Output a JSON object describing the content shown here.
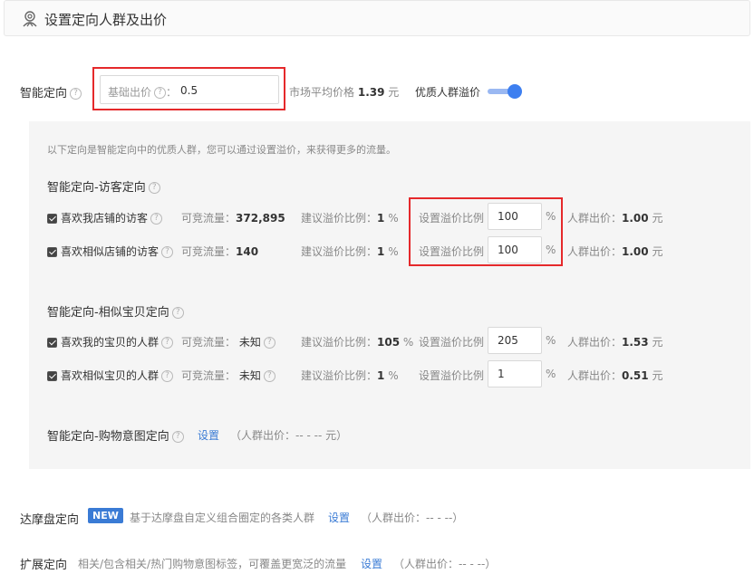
{
  "header": {
    "title": "设置定向人群及出价"
  },
  "smart": {
    "label": "智能定向",
    "base_price_label": "基础出价",
    "base_price_colon": "：",
    "base_price_value": "0.5",
    "market_avg_label": "市场平均价格",
    "market_avg_value": "1.39",
    "market_avg_unit": "元",
    "premium_label": "优质人群溢价",
    "premium_enabled": true,
    "desc": "以下定向是智能定向中的优质人群，您可以通过设置溢价，来获得更多的流量。"
  },
  "groups": [
    {
      "title": "智能定向-访客定向",
      "rows": [
        {
          "name": "喜欢我店铺的访客",
          "traffic_label": "可竞流量：",
          "traffic": "372,895",
          "suggest_label": "建议溢价比例：",
          "suggest": "1",
          "set_label": "设置溢价比例",
          "value": "100",
          "unit": "%",
          "bid_label": "人群出价：",
          "bid": "1.00",
          "bid_unit": "元"
        },
        {
          "name": "喜欢相似店铺的访客",
          "traffic_label": "可竞流量：",
          "traffic": "140",
          "suggest_label": "建议溢价比例：",
          "suggest": "1",
          "set_label": "设置溢价比例",
          "value": "100",
          "unit": "%",
          "bid_label": "人群出价：",
          "bid": "1.00",
          "bid_unit": "元"
        }
      ]
    },
    {
      "title": "智能定向-相似宝贝定向",
      "rows": [
        {
          "name": "喜欢我的宝贝的人群",
          "traffic_label": "可竞流量：",
          "traffic": "未知",
          "suggest_label": "建议溢价比例：",
          "suggest": "105",
          "set_label": "设置溢价比例",
          "value": "205",
          "unit": "%",
          "bid_label": "人群出价：",
          "bid": "1.53",
          "bid_unit": "元"
        },
        {
          "name": "喜欢相似宝贝的人群",
          "traffic_label": "可竞流量：",
          "traffic": "未知",
          "suggest_label": "建议溢价比例：",
          "suggest": "1",
          "set_label": "设置溢价比例",
          "value": "1",
          "unit": "%",
          "bid_label": "人群出价：",
          "bid": "0.51",
          "bid_unit": "元"
        }
      ]
    }
  ],
  "intent": {
    "title": "智能定向-购物意图定向",
    "setting": "设置",
    "bid_text": "（人群出价：-- - -- 元）"
  },
  "damopan": {
    "label": "达摩盘定向",
    "badge": "NEW",
    "desc": "基于达摩盘自定义组合圈定的各类人群",
    "setting": "设置",
    "bid_text": "（人群出价：-- - --）"
  },
  "extend": {
    "label": "扩展定向",
    "desc": "相关/包含相关/热门购物意图标签，可覆盖更宽泛的流量",
    "setting": "设置",
    "bid_text": "（人群出价：-- - --）"
  },
  "colors": {
    "accent": "#3a7bd5",
    "highlight": "#e5292b",
    "toggle": "#3d7ff0"
  },
  "icons": {
    "header": "target-people-icon",
    "help": "question-circle-icon",
    "checkbox": "checkbox-checked-icon"
  }
}
